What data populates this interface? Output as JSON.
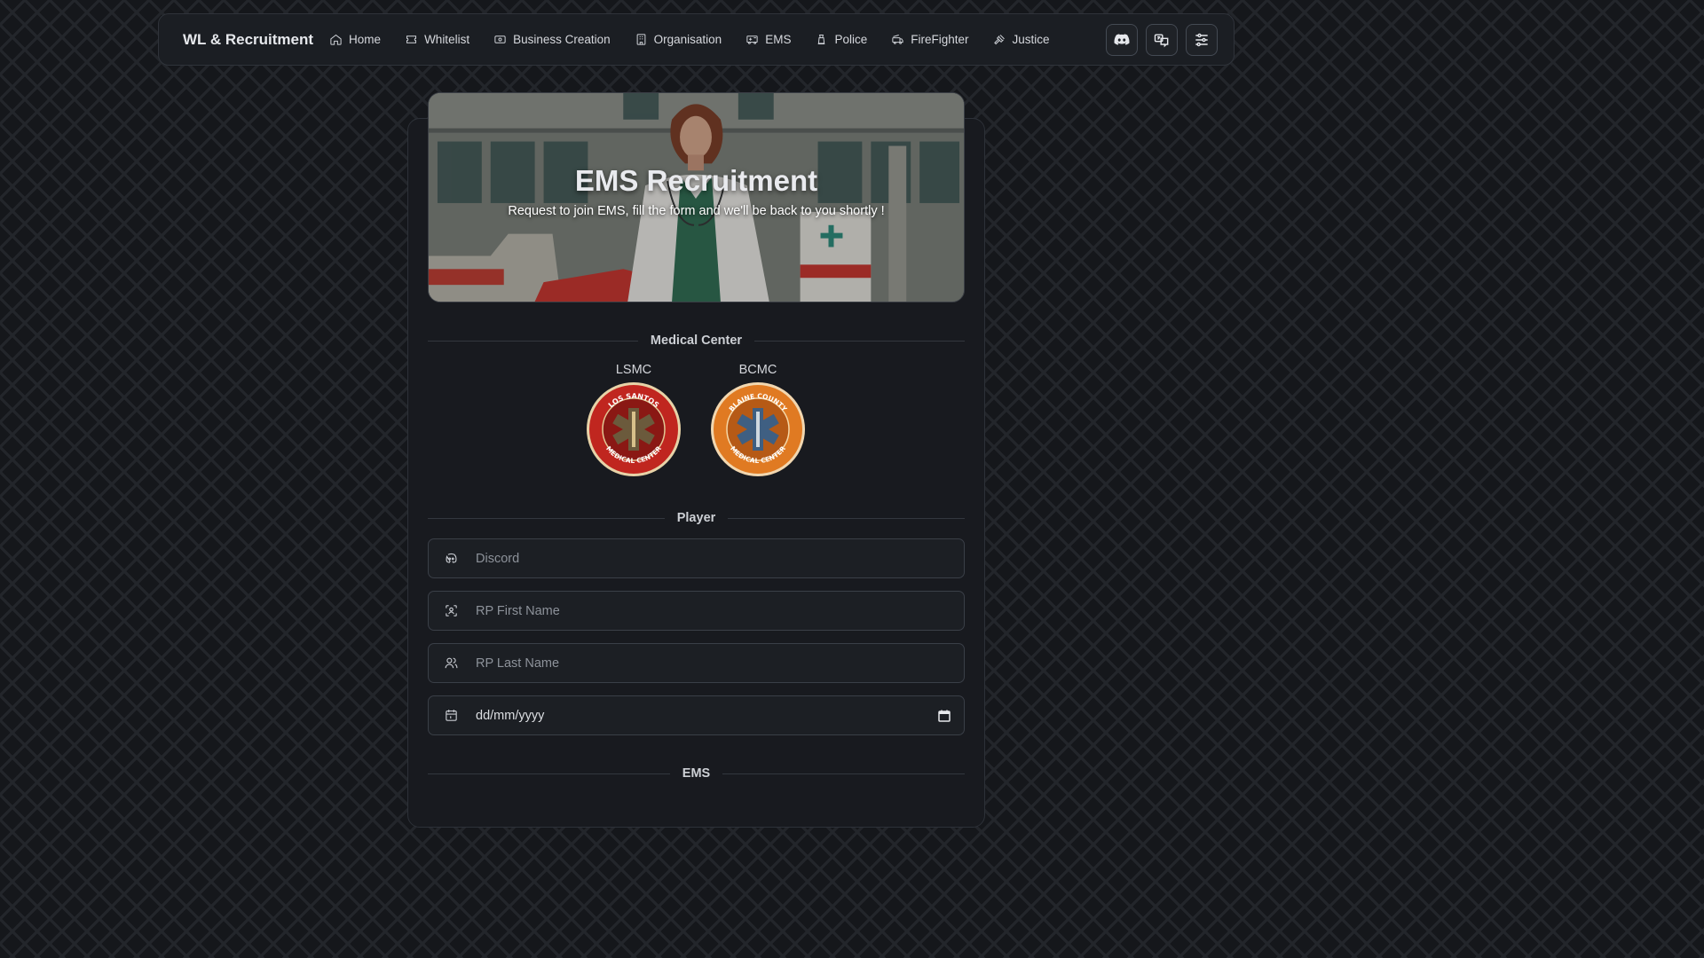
{
  "nav": {
    "brand": "WL & Recruitment",
    "items": [
      {
        "label": "Home",
        "icon": "home-icon"
      },
      {
        "label": "Whitelist",
        "icon": "ticket-icon"
      },
      {
        "label": "Business Creation",
        "icon": "cash-icon"
      },
      {
        "label": "Organisation",
        "icon": "building-icon"
      },
      {
        "label": "EMS",
        "icon": "ambulance-icon"
      },
      {
        "label": "Police",
        "icon": "police-icon"
      },
      {
        "label": "FireFighter",
        "icon": "firetruck-icon"
      },
      {
        "label": "Justice",
        "icon": "gavel-icon"
      }
    ],
    "actions": [
      "discord-icon",
      "translate-icon",
      "settings-icon"
    ]
  },
  "hero": {
    "title": "EMS Recruitment",
    "subtitle": "Request to join EMS, fill the form and we'll be back to you shortly !"
  },
  "sections": {
    "medical_center": "Medical Center",
    "player": "Player",
    "ems": "EMS"
  },
  "centers": [
    {
      "code": "LSMC",
      "seal_top": "LOS SANTOS",
      "seal_bottom": "MEDICAL CENTER",
      "color": "#c0261f"
    },
    {
      "code": "BCMC",
      "seal_top": "BLAINE COUNTY",
      "seal_bottom": "MEDICAL CENTER",
      "color": "#e07a22"
    }
  ],
  "form": {
    "discord_placeholder": "Discord",
    "first_name_placeholder": "RP First Name",
    "last_name_placeholder": "RP Last Name",
    "date_placeholder": "dd/mm/yyyy"
  },
  "colors": {
    "background": "#15171b",
    "card": "#181a1f",
    "input": "#1c1f24"
  }
}
